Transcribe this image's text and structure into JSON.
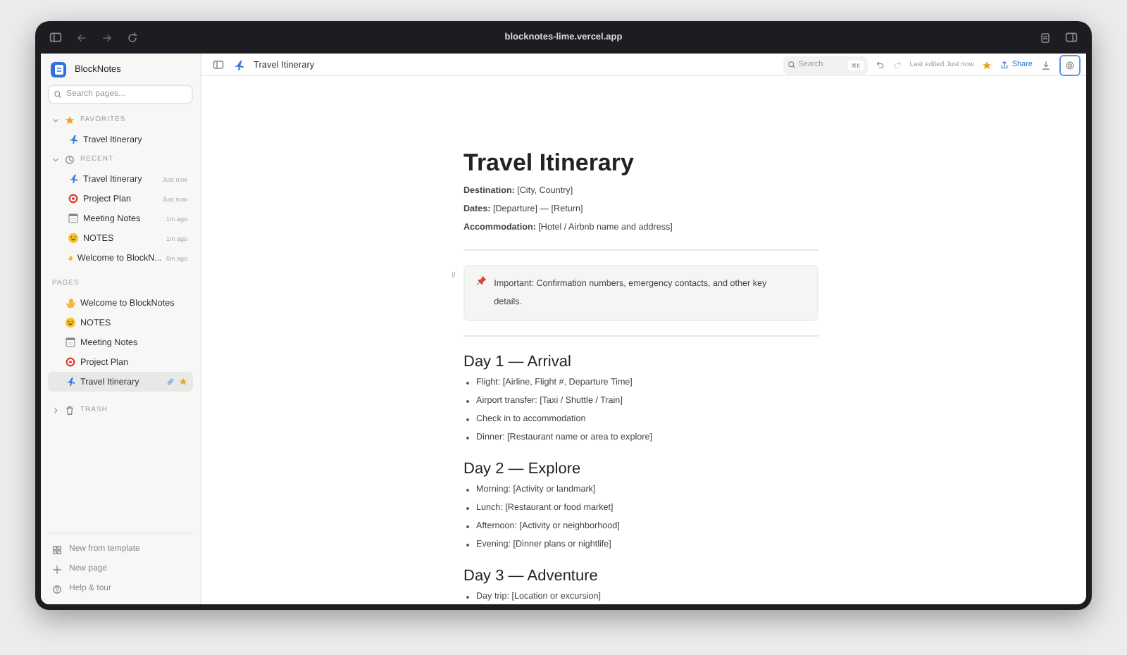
{
  "browser": {
    "url": "blocknotes-lime.vercel.app"
  },
  "sidebar": {
    "app_name": "BlockNotes",
    "search": {
      "placeholder": "Search pages..."
    },
    "sections": [
      {
        "kind": "favorites",
        "title": "FAVORITES",
        "expanded": true,
        "items": [
          {
            "kind": "plane",
            "label": "Travel Itinerary"
          }
        ]
      },
      {
        "kind": "recent",
        "title": "RECENT",
        "expanded": true,
        "items": [
          {
            "kind": "plane",
            "label": "Travel Itinerary",
            "time": "Just now"
          },
          {
            "kind": "target",
            "label": "Project Plan",
            "time": "Just now"
          },
          {
            "kind": "calendar",
            "label": "Meeting Notes",
            "time": "1m ago"
          },
          {
            "kind": "smiley",
            "label": "NOTES",
            "time": "1m ago"
          },
          {
            "kind": "wave",
            "label": "Welcome to BlockN...",
            "time": "6m ago"
          }
        ]
      },
      {
        "kind": "pages",
        "title": "PAGES",
        "items": [
          {
            "kind": "wave",
            "label": "Welcome to BlockNotes",
            "selected": false
          },
          {
            "kind": "smiley",
            "label": "NOTES",
            "selected": false
          },
          {
            "kind": "calendar",
            "label": "Meeting Notes",
            "selected": false
          },
          {
            "kind": "target",
            "label": "Project Plan",
            "selected": false
          },
          {
            "kind": "plane",
            "label": "Travel Itinerary",
            "selected": true
          }
        ]
      }
    ],
    "trash": {
      "title": "TRASH",
      "expanded": false
    },
    "footer": [
      {
        "kind": "template",
        "label": "New from template"
      },
      {
        "kind": "new",
        "label": "New page"
      },
      {
        "kind": "help",
        "label": "Help & tour"
      }
    ]
  },
  "header": {
    "kind": "plane",
    "title": "Travel Itinerary",
    "search": {
      "placeholder": "Search",
      "shortcut": "⌘K"
    },
    "status": "Last edited Just now",
    "favorite": true,
    "share": "Share"
  },
  "document": {
    "title": "Travel Itinerary",
    "meta": [
      "**Destination:** [City, Country]",
      "**Dates:** [Departure] — [Return]",
      "**Accommodation:** [Hotel / Airbnb name and address]"
    ],
    "callout": "Important: Confirmation numbers, emergency contacts, and other key details.",
    "sections": [
      {
        "heading": "Day 1 — Arrival",
        "items": [
          "Flight: [Airline, Flight #, Departure Time]",
          "Airport transfer: [Taxi / Shuttle / Train]",
          "Check in to accommodation",
          "Dinner: [Restaurant name or area to explore]"
        ]
      },
      {
        "heading": "Day 2 — Explore",
        "items": [
          "Morning: [Activity or landmark]",
          "Lunch: [Restaurant or food market]",
          "Afternoon: [Activity or neighborhood]",
          "Evening: [Dinner plans or nightlife]"
        ]
      },
      {
        "heading": "Day 3 — Adventure",
        "items": [
          "Day trip: [Location or excursion]"
        ]
      }
    ]
  }
}
